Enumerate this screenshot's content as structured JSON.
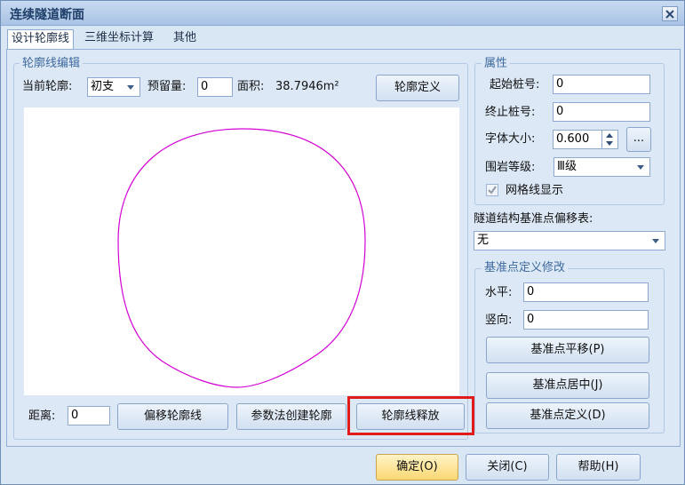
{
  "window": {
    "title": "连续隧道断面"
  },
  "tabs": [
    {
      "label": "设计轮廓线",
      "active": true
    },
    {
      "label": "三维坐标计算",
      "active": false
    },
    {
      "label": "其他",
      "active": false
    }
  ],
  "contour_edit": {
    "group_title": "轮廓线编辑",
    "current_label": "当前轮廓:",
    "current_value": "初支",
    "reserve_label": "预留量:",
    "reserve_value": "0",
    "area_label": "面积:",
    "area_value": "38.7946m²",
    "define_button": "轮廓定义",
    "distance_label": "距离:",
    "distance_value": "0",
    "offset_button": "偏移轮廓线",
    "param_button": "参数法创建轮廓",
    "release_button": "轮廓线释放"
  },
  "properties": {
    "group_title": "属性",
    "start_label": "起始桩号:",
    "start_value": "0",
    "end_label": "终止桩号:",
    "end_value": "0",
    "font_label": "字体大小:",
    "font_value": "0.600",
    "font_more": "...",
    "rock_label": "围岩等级:",
    "rock_value": "Ⅲ级",
    "grid_label": "网格线显示",
    "grid_checked": true
  },
  "offset_table": {
    "label": "隧道结构基准点偏移表:",
    "value": "无"
  },
  "base_edit": {
    "group_title": "基准点定义修改",
    "h_label": "水平:",
    "h_value": "0",
    "v_label": "竖向:",
    "v_value": "0",
    "move_button": "基准点平移(P)",
    "center_button": "基准点居中(J)",
    "define_button": "基准点定义(D)"
  },
  "footer": {
    "ok_button": "确定(O)",
    "close_button": "关闭(C)",
    "help_button": "帮助(H)"
  },
  "colors": {
    "contour_stroke": "#d400d4",
    "highlight": "#e11a1a"
  },
  "icons": {
    "close": "close-icon",
    "dropdown": "chevron-down-icon",
    "spin": "spin-arrows-icon",
    "check": "check-icon"
  }
}
